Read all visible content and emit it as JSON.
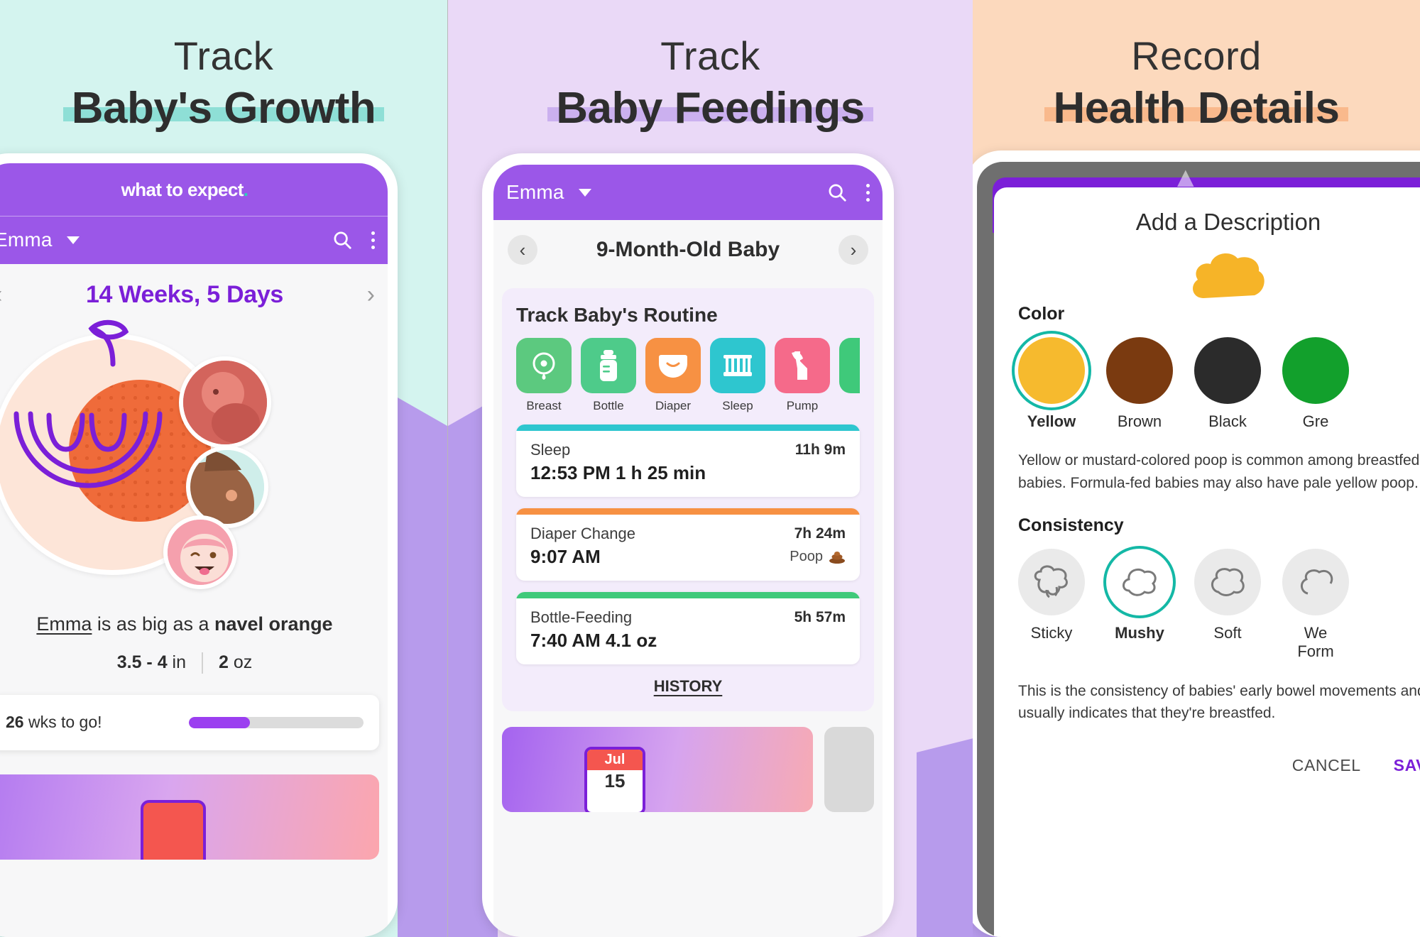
{
  "panels": [
    {
      "bg": "#d4f4ef",
      "headline_small": "Track",
      "headline_big": "Baby's Growth",
      "underline_color": "#8edfd6"
    },
    {
      "bg": "#ead9f7",
      "headline_small": "Track",
      "headline_big": "Baby Feedings",
      "underline_color": "#cbb0ef"
    },
    {
      "bg": "#fcd9bd",
      "headline_small": "Record",
      "headline_big": "Health Details",
      "underline_color": "#f9b98c"
    }
  ],
  "brand": {
    "logo": "what to expect",
    "logo_dot": ".",
    "purple": "#9b57e8",
    "accent_teal": "#2ad3b6"
  },
  "phone1": {
    "appbar": {
      "name": "Emma",
      "caret_icon": "chevron-down-icon",
      "search_icon": "search-icon",
      "menu_icon": "overflow-menu-icon"
    },
    "week": {
      "prev_icon": "chevron-left-icon",
      "title": "14 Weeks, 5 Days",
      "next_icon": "chevron-right-icon"
    },
    "size_line_name": "Emma",
    "size_line_mid": " is as big as a ",
    "size_line_fruit": "navel orange",
    "length_value": "3.5  -  4",
    "length_unit": "in",
    "weight_value": "2",
    "weight_unit": "oz",
    "progress": {
      "weeks_number": "26",
      "weeks_label": "wks to go!",
      "percent": 35
    }
  },
  "phone2": {
    "appbar": {
      "name": "Emma",
      "caret_icon": "chevron-down-icon",
      "search_icon": "search-icon",
      "menu_icon": "overflow-menu-icon"
    },
    "subbar": {
      "prev_icon": "chevron-left-icon",
      "title": "9-Month-Old Baby",
      "next_icon": "chevron-right-icon"
    },
    "routine_title": "Track Baby's Routine",
    "trackers": [
      {
        "label": "Breast",
        "color": "#5cc97f",
        "icon": "breast-feeding-icon"
      },
      {
        "label": "Bottle",
        "color": "#4ecb8a",
        "icon": "bottle-icon"
      },
      {
        "label": "Diaper",
        "color": "#f79143",
        "icon": "diaper-icon"
      },
      {
        "label": "Sleep",
        "color": "#2ec6cf",
        "icon": "crib-icon"
      },
      {
        "label": "Pump",
        "color": "#f56a8a",
        "icon": "breast-pump-icon"
      },
      {
        "label": "",
        "color": "#3fc97a",
        "icon": "more-icon"
      }
    ],
    "logs": [
      {
        "bar_color": "#2ec6cf",
        "name": "Sleep",
        "ago": "11h 9m",
        "main": "12:53 PM   1 h 25 min",
        "note": "",
        "note_icon": ""
      },
      {
        "bar_color": "#f79143",
        "name": "Diaper Change",
        "ago": "7h 24m",
        "main": "9:07 AM",
        "note": "Poop",
        "note_icon": "poop-icon"
      },
      {
        "bar_color": "#3fc97a",
        "name": "Bottle-Feeding",
        "ago": "5h 57m",
        "main": "7:40 AM   4.1 oz",
        "note": "",
        "note_icon": ""
      }
    ],
    "history_label": "HISTORY",
    "calendar": {
      "month": "Jul",
      "day": "15"
    }
  },
  "phone3": {
    "sheet_title": "Add a Description",
    "poop_icon": "poop-blob-icon",
    "color_label": "Color",
    "colors": [
      {
        "name": "Yellow",
        "hex": "#f6ba2e",
        "selected": true
      },
      {
        "name": "Brown",
        "hex": "#7a3a10",
        "selected": false
      },
      {
        "name": "Black",
        "hex": "#2b2b2b",
        "selected": false
      },
      {
        "name": "Gre",
        "hex": "#12a02c",
        "selected": false
      }
    ],
    "color_description": "Yellow or mustard-colored poop is common among breastfed babies. Formula-fed babies may also have pale yellow poop.",
    "consistency_label": "Consistency",
    "consistencies": [
      {
        "name": "Sticky",
        "selected": false,
        "icon": "sticky-blob-icon"
      },
      {
        "name": "Mushy",
        "selected": true,
        "icon": "mushy-blob-icon"
      },
      {
        "name": "Soft",
        "selected": false,
        "icon": "soft-blob-icon"
      },
      {
        "name": "We\nForm",
        "selected": false,
        "icon": "formed-blob-icon"
      }
    ],
    "consistency_description": "This is the consistency of babies' early bowel movements and usually indicates that they're breastfed.",
    "cancel_label": "CANCEL",
    "save_label": "SAVE"
  }
}
